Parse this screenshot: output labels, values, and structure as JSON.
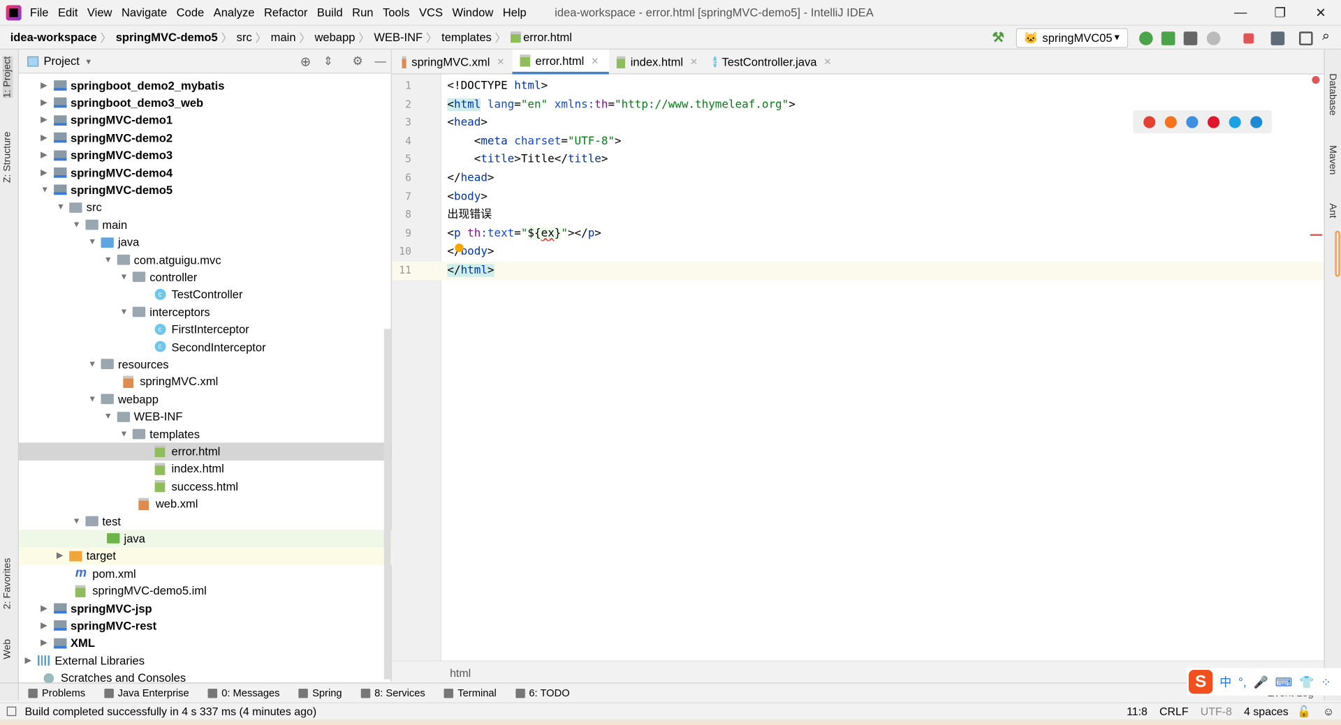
{
  "app": {
    "title": "idea-workspace - error.html [springMVC-demo5] - IntelliJ IDEA",
    "menu": [
      "File",
      "Edit",
      "View",
      "Navigate",
      "Code",
      "Analyze",
      "Refactor",
      "Build",
      "Run",
      "Tools",
      "VCS",
      "Window",
      "Help"
    ]
  },
  "window_controls": {
    "minimize": "—",
    "restore": "❐",
    "close": "✕"
  },
  "breadcrumbs": [
    {
      "label": "idea-workspace",
      "bold": true
    },
    {
      "label": "springMVC-demo5",
      "bold": true
    },
    {
      "label": "src"
    },
    {
      "label": "main"
    },
    {
      "label": "webapp"
    },
    {
      "label": "WEB-INF"
    },
    {
      "label": "templates"
    },
    {
      "label": "error.html",
      "icon": "html-file-icon"
    }
  ],
  "toolbar": {
    "run_config": "springMVC05",
    "icons": [
      "build-hammer-icon",
      "rerun-icon",
      "debug-icon",
      "coverage-icon",
      "profile-icon",
      "stop-icon",
      "project-structure-icon",
      "terminal-icon",
      "search-icon"
    ]
  },
  "left_strip": {
    "items": [
      "1: Project",
      "Z: Structure",
      "2: Favorites",
      "Web"
    ]
  },
  "right_strip": {
    "items": [
      "Database",
      "Maven",
      "Ant"
    ]
  },
  "project_panel": {
    "title": "Project",
    "tree": [
      {
        "label": "springboot_demo2_mybatis",
        "level": 1,
        "arrow": "right",
        "icon": "module",
        "bold": true
      },
      {
        "label": "springboot_demo3_web",
        "level": 1,
        "arrow": "right",
        "icon": "module",
        "bold": true
      },
      {
        "label": "springMVC-demo1",
        "level": 1,
        "arrow": "right",
        "icon": "module",
        "bold": true
      },
      {
        "label": "springMVC-demo2",
        "level": 1,
        "arrow": "right",
        "icon": "module",
        "bold": true
      },
      {
        "label": "springMVC-demo3",
        "level": 1,
        "arrow": "right",
        "icon": "module",
        "bold": true
      },
      {
        "label": "springMVC-demo4",
        "level": 1,
        "arrow": "right",
        "icon": "module",
        "bold": true
      },
      {
        "label": "springMVC-demo5",
        "level": 1,
        "arrow": "down",
        "icon": "module",
        "bold": true
      },
      {
        "label": "src",
        "level": 2,
        "arrow": "down",
        "icon": "folder"
      },
      {
        "label": "main",
        "level": 3,
        "arrow": "down",
        "icon": "folder"
      },
      {
        "label": "java",
        "level": 4,
        "arrow": "down",
        "icon": "folder blue"
      },
      {
        "label": "com.atguigu.mvc",
        "level": 5,
        "arrow": "down",
        "icon": "folder"
      },
      {
        "label": "controller",
        "level": 6,
        "arrow": "down",
        "icon": "folder"
      },
      {
        "label": "TestController",
        "level": 7,
        "icon": "cls"
      },
      {
        "label": "interceptors",
        "level": 6,
        "arrow": "down",
        "icon": "folder"
      },
      {
        "label": "FirstInterceptor",
        "level": 7,
        "icon": "cls"
      },
      {
        "label": "SecondInterceptor",
        "level": 7,
        "icon": "cls"
      },
      {
        "label": "resources",
        "level": 4,
        "arrow": "down",
        "icon": "folder"
      },
      {
        "label": "springMVC.xml",
        "level": 5,
        "icon": "xml"
      },
      {
        "label": "webapp",
        "level": 4,
        "arrow": "down",
        "icon": "folder"
      },
      {
        "label": "WEB-INF",
        "level": 5,
        "arrow": "down",
        "icon": "folder"
      },
      {
        "label": "templates",
        "level": 6,
        "arrow": "down",
        "icon": "folder"
      },
      {
        "label": "error.html",
        "level": 7,
        "icon": "html",
        "selected": true
      },
      {
        "label": "index.html",
        "level": 7,
        "icon": "html"
      },
      {
        "label": "success.html",
        "level": 7,
        "icon": "html"
      },
      {
        "label": "web.xml",
        "level": 6,
        "icon": "xml"
      },
      {
        "label": "test",
        "level": 3,
        "arrow": "down",
        "icon": "folder"
      },
      {
        "label": "java",
        "level": 4,
        "icon": "folder green",
        "highlight": "green"
      },
      {
        "label": "target",
        "level": 2,
        "arrow": "right",
        "icon": "folder orange",
        "highlight": "yellow"
      },
      {
        "label": "pom.xml",
        "level": 2,
        "icon": "pom"
      },
      {
        "label": "springMVC-demo5.iml",
        "level": 2,
        "icon": "iml"
      },
      {
        "label": "springMVC-jsp",
        "level": 1,
        "arrow": "right",
        "icon": "module",
        "bold": true
      },
      {
        "label": "springMVC-rest",
        "level": 1,
        "arrow": "right",
        "icon": "module",
        "bold": true
      },
      {
        "label": "XML",
        "level": 1,
        "arrow": "right",
        "icon": "module",
        "bold": true
      },
      {
        "label": "External Libraries",
        "level": 0,
        "arrow": "right",
        "icon": "lib"
      },
      {
        "label": "Scratches and Consoles",
        "level": 0,
        "icon": "scratch"
      }
    ]
  },
  "tabs": [
    {
      "label": "springMVC.xml",
      "icon": "xml"
    },
    {
      "label": "error.html",
      "icon": "html",
      "active": true
    },
    {
      "label": "index.html",
      "icon": "html"
    },
    {
      "label": "TestController.java",
      "icon": "cls"
    }
  ],
  "editor": {
    "current_line": 11,
    "lines": [
      [
        [
          "<!DOCTYPE ",
          "plain"
        ],
        [
          "html",
          "tag"
        ],
        [
          ">",
          "plain"
        ]
      ],
      [
        [
          "<",
          "plain hl"
        ],
        [
          "html",
          "tag hl"
        ],
        [
          " ",
          "plain"
        ],
        [
          "lang",
          "attr"
        ],
        [
          "=",
          "plain"
        ],
        [
          "\"en\"",
          "str"
        ],
        [
          " ",
          "plain"
        ],
        [
          "xmlns:",
          "attr"
        ],
        [
          "th",
          "ns"
        ],
        [
          "=",
          "plain"
        ],
        [
          "\"http://www.thymeleaf.org\"",
          "str"
        ],
        [
          ">",
          "plain"
        ]
      ],
      [
        [
          "<",
          "plain"
        ],
        [
          "head",
          "tag"
        ],
        [
          ">",
          "plain"
        ]
      ],
      [
        [
          "    <",
          "plain"
        ],
        [
          "meta",
          "tag"
        ],
        [
          " ",
          "plain"
        ],
        [
          "charset",
          "attr"
        ],
        [
          "=",
          "plain"
        ],
        [
          "\"UTF-8\"",
          "str"
        ],
        [
          ">",
          "plain"
        ]
      ],
      [
        [
          "    <",
          "plain"
        ],
        [
          "title",
          "tag"
        ],
        [
          ">Title</",
          "plain"
        ],
        [
          "title",
          "tag"
        ],
        [
          ">",
          "plain"
        ]
      ],
      [
        [
          "</",
          "plain"
        ],
        [
          "head",
          "tag"
        ],
        [
          ">",
          "plain"
        ]
      ],
      [
        [
          "<",
          "plain"
        ],
        [
          "body",
          "tag"
        ],
        [
          ">",
          "plain"
        ]
      ],
      [
        [
          "出现错误",
          "plain"
        ]
      ],
      [
        [
          "<",
          "plain"
        ],
        [
          "p",
          "tag"
        ],
        [
          " ",
          "plain"
        ],
        [
          "th",
          "ns"
        ],
        [
          ":text",
          "attr"
        ],
        [
          "=",
          "plain"
        ],
        [
          "\"",
          "str"
        ],
        [
          "${",
          "plain expr"
        ],
        [
          "ex",
          "plain expr err"
        ],
        [
          "}",
          "plain expr"
        ],
        [
          "\"",
          "str"
        ],
        [
          "></",
          "plain"
        ],
        [
          "p",
          "tag"
        ],
        [
          ">",
          "plain"
        ]
      ],
      [
        [
          "</",
          "plain"
        ],
        [
          "body",
          "tag"
        ],
        [
          ">",
          "plain"
        ]
      ],
      [
        [
          "</",
          "plain hl"
        ],
        [
          "html",
          "tag hl"
        ],
        [
          ">",
          "plain hl"
        ]
      ]
    ],
    "browsers": [
      {
        "name": "chrome-icon",
        "color": "#e34133"
      },
      {
        "name": "firefox-icon",
        "color": "#f4731c"
      },
      {
        "name": "safari-icon",
        "color": "#3f8fe0"
      },
      {
        "name": "opera-icon",
        "color": "#e0162b"
      },
      {
        "name": "ie-icon",
        "color": "#1ba1e2"
      },
      {
        "name": "edge-icon",
        "color": "#1d8ad1"
      }
    ],
    "breadcrumb": "html"
  },
  "tool_windows": [
    "Problems",
    "Java Enterprise",
    "0: Messages",
    "Spring",
    "8: Services",
    "Terminal",
    "6: TODO"
  ],
  "event_log": "Event Log",
  "status": {
    "message": "Build completed successfully in 4 s 337 ms (4 minutes ago)",
    "position": "11:8",
    "line_sep": "CRLF",
    "encoding": "UTF-8",
    "indent": "4 spaces"
  },
  "ime": {
    "logo": "S",
    "items": [
      "中",
      "°,",
      "🎤",
      "⌨",
      "👕",
      "⁘"
    ]
  },
  "colors": {
    "accent": "#4083c9",
    "selection": "#d5d5d5",
    "stop": "#e05555"
  }
}
